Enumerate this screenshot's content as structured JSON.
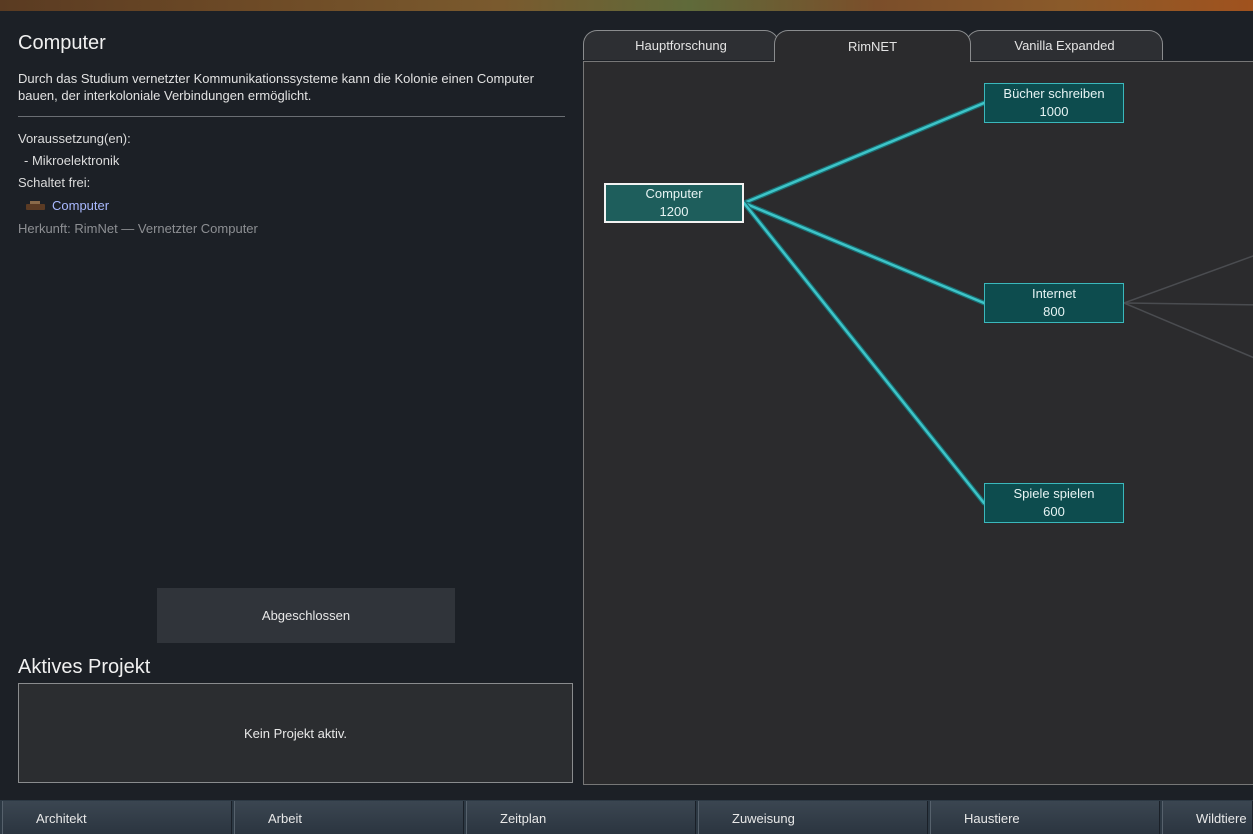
{
  "detail": {
    "title": "Computer",
    "description": "Durch das Studium vernetzter Kommunikationssysteme kann die Kolonie einen Computer bauen, der interkoloniale Verbindungen ermöglicht.",
    "prereq_label": "Voraussetzung(en):",
    "prereq_item": "- Mikroelektronik",
    "unlocks_label": "Schaltet frei:",
    "unlock_item": "Computer",
    "origin": "Herkunft:  RimNet — Vernetzter Computer",
    "status_button": "Abgeschlossen"
  },
  "active_project": {
    "title": "Aktives Projekt",
    "empty_text": "Kein Projekt aktiv."
  },
  "tabs": [
    {
      "label": "Hauptforschung",
      "active": false
    },
    {
      "label": "RimNET",
      "active": true
    },
    {
      "label": "Vanilla Expanded",
      "active": false
    }
  ],
  "nodes": [
    {
      "name": "Computer",
      "cost": "1200",
      "selected": true
    },
    {
      "name": "Bücher schreiben",
      "cost": "1000"
    },
    {
      "name": "Internet",
      "cost": "800"
    },
    {
      "name": "Spiele spielen",
      "cost": "600"
    }
  ],
  "colors": {
    "link_active": "#3ec4c8",
    "link_inactive": "#4a4c50",
    "node_fill": "#0d4c4e",
    "node_border": "#3ab8bc"
  },
  "bottom_bar": [
    "Architekt",
    "Arbeit",
    "Zeitplan",
    "Zuweisung",
    "Haustiere",
    "Wildtiere"
  ]
}
